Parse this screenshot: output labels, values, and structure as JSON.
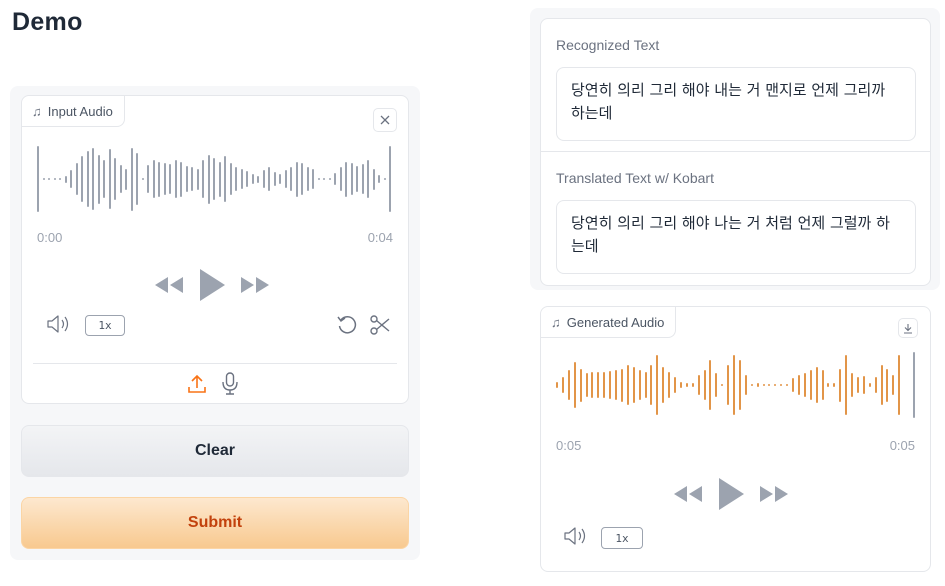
{
  "page": {
    "title": "Demo"
  },
  "input_audio": {
    "label": "Input Audio",
    "time_start": "0:00",
    "time_end": "0:04",
    "speed": "1x",
    "wave_color": "#9ca3af"
  },
  "buttons": {
    "clear": "Clear",
    "submit": "Submit"
  },
  "output": {
    "recognized_label": "Recognized Text",
    "recognized_value": "당연히 의리 그리 해야 내는 거 맨지로 언제 그리까 하는데",
    "translated_label": "Translated Text w/ Kobart",
    "translated_value": "당연히 의리 그리 해야 나는 거 처럼 언제 그럴까 하는데"
  },
  "generated_audio": {
    "label": "Generated Audio",
    "time_start": "0:05",
    "time_end": "0:05",
    "speed": "1x",
    "wave_color": "#e29548"
  },
  "colors": {
    "accent": "#f97316",
    "gray_icon": "#6b7280"
  }
}
